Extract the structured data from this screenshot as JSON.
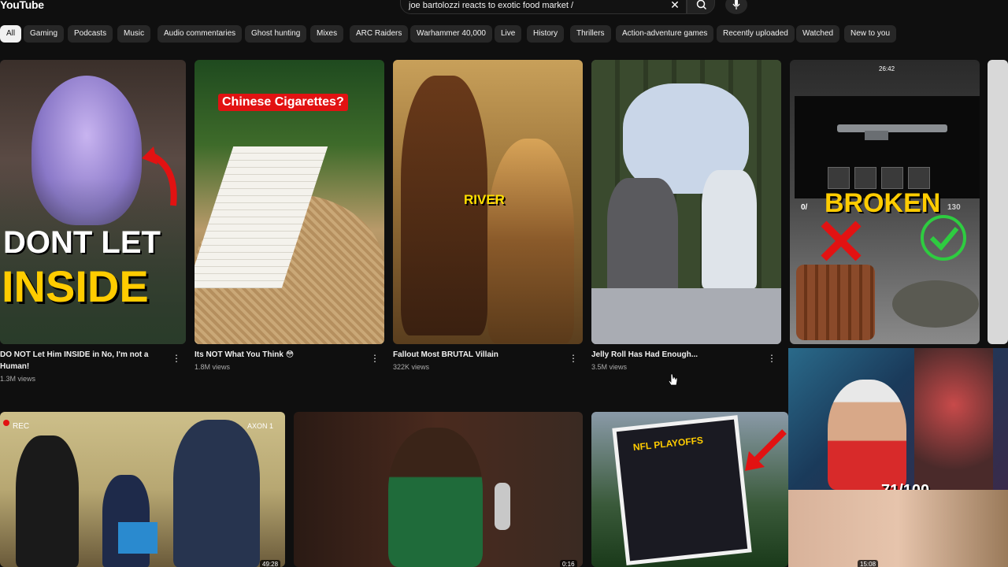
{
  "app": {
    "logo": "YouTube"
  },
  "search": {
    "query": "joe bartolozzi reacts to exotic food market /"
  },
  "chips": [
    "All",
    "Gaming",
    "Podcasts",
    "Music",
    "Audio commentaries",
    "Ghost hunting",
    "Mixes",
    "ARC Raiders",
    "Warhammer 40,000",
    "Live",
    "History",
    "Thrillers",
    "Action-adventure games",
    "Recently uploaded",
    "Watched",
    "New to you"
  ],
  "videos": [
    {
      "title_line1": "DO NOT Let Him INSIDE in No, I'm not a",
      "title_line2": "Human!",
      "views": "1.3M views",
      "thumb_text1": "DONT LET",
      "thumb_text2": "INSIDE"
    },
    {
      "title_line1": "Its NOT What You Think 😳",
      "views": "1.8M views",
      "thumb_text1": "Chinese Cigarettes?"
    },
    {
      "title_line1": "Fallout Most BRUTAL Villain",
      "views": "322K views",
      "thumb_text1": "RIVER"
    },
    {
      "title_line1": "Jelly Roll Has Had Enough...",
      "views": "3.5M views"
    },
    {
      "thumb_text1": "BROKEN",
      "thumb_small": "0/",
      "thumb_small2": "130",
      "duration": "26:42"
    }
  ],
  "row2": [
    {
      "rec_label": "REC",
      "corner_label": "AXON 1",
      "duration": "49:28"
    },
    {
      "duration": "0:16"
    },
    {
      "thumb_text1": "NFL PLAYOFFS",
      "duration": "15:08"
    }
  ],
  "webcam": {
    "score": "71/100"
  },
  "colors": {
    "bg": "#0f0f0f",
    "chip": "#272727",
    "chip_active": "#f1f1f1",
    "red": "#e21212"
  }
}
